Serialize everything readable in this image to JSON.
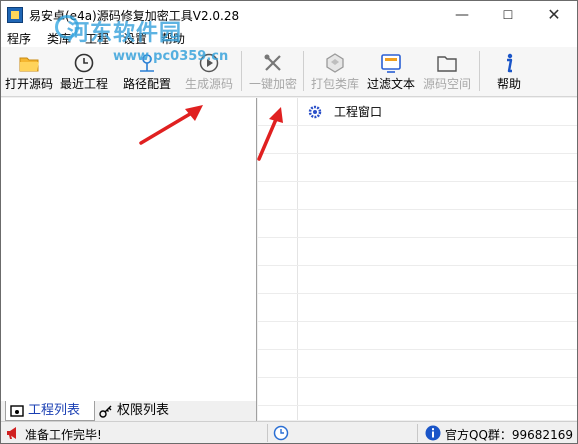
{
  "window": {
    "title": "易安卓(e4a)源码修复加密工具V2.0.28",
    "minimize_glyph": "—",
    "maximize_glyph": "☐",
    "close_glyph": "✕"
  },
  "menu": {
    "items": [
      "程序",
      "类库",
      "工程",
      "设置",
      "帮助"
    ]
  },
  "watermark": {
    "line1": "河东软件园",
    "line2": "www.pc0359.cn"
  },
  "toolbar": {
    "buttons": [
      {
        "label": "打开源码",
        "icon": "folder-open-icon",
        "enabled": true
      },
      {
        "label": "最近工程",
        "icon": "clock-icon",
        "enabled": true
      },
      {
        "label": "路径配置",
        "icon": "path-config-icon",
        "enabled": true
      },
      {
        "label": "生成源码",
        "icon": "play-icon",
        "enabled": false
      },
      {
        "label": "一键加密",
        "icon": "tools-icon",
        "enabled": false
      },
      {
        "label": "打包类库",
        "icon": "package-icon",
        "enabled": false
      },
      {
        "label": "过滤文本",
        "icon": "filter-text-icon",
        "enabled": true
      },
      {
        "label": "源码空间",
        "icon": "folder-icon",
        "enabled": false
      },
      {
        "label": "帮助",
        "icon": "info-icon",
        "enabled": true
      }
    ]
  },
  "workspace": {
    "project_window_label": "工程窗口"
  },
  "tabs": {
    "project_list": "工程列表",
    "permission_list": "权限列表"
  },
  "status": {
    "text": "准备工作完毕!",
    "qq_group": "官方QQ群：99682169"
  },
  "colors": {
    "accent": "#1a3fb3",
    "annotation_arrow": "#e02020",
    "watermark": "#3aa3dc"
  }
}
